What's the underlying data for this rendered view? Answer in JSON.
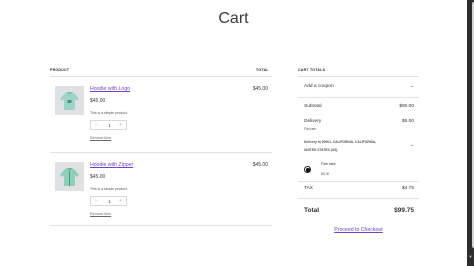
{
  "page": {
    "title": "Cart"
  },
  "table": {
    "product_header": "PRODUCT",
    "total_header": "TOTAL"
  },
  "items": [
    {
      "name": "Hoodie with Logo",
      "price": "$45.00",
      "description": "This is a simple product.",
      "quantity": "1",
      "remove_label": "Remove item",
      "line_total": "$45.00",
      "image": "hoodie-logo-image"
    },
    {
      "name": "Hoodie with Zipper",
      "price": "$45.00",
      "description": "This is a simple product.",
      "quantity": "1",
      "remove_label": "Remove item",
      "line_total": "$45.00",
      "image": "hoodie-zipper-image"
    }
  ],
  "totals": {
    "header": "CART TOTALS",
    "coupon_label": "Add a coupon",
    "subtotal_label": "Subtotal",
    "subtotal_value": "$90.00",
    "delivery_label": "Delivery",
    "delivery_value": "$5.00",
    "delivery_method": "Flat rate",
    "delivery_address_line1": "Delivery to 90001, CALIFORNIA, CALIFORNIA,",
    "delivery_address_line2": "UNITED STATES (US)",
    "option_label": "Flat rate",
    "option_price": "$5.00",
    "tax_label": "TAX",
    "tax_value": "$4.75",
    "total_label": "Total",
    "total_value": "$99.75",
    "checkout_label": "Proceed to Checkout"
  }
}
